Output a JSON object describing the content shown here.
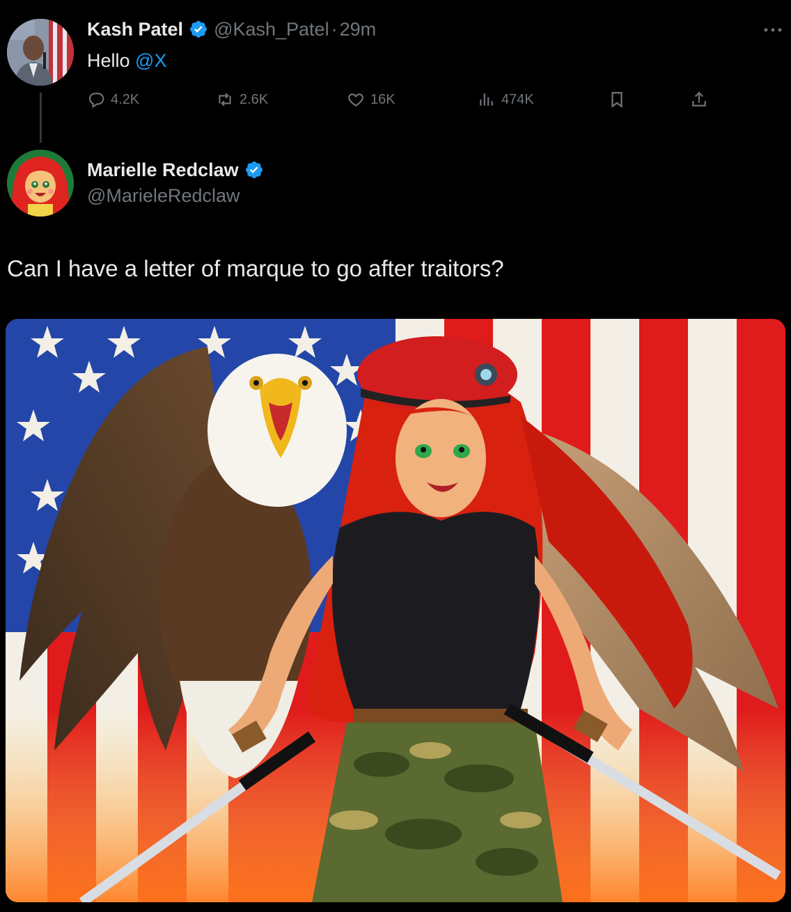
{
  "parent_tweet": {
    "display_name": "Kash Patel",
    "handle": "@Kash_Patel",
    "separator": "·",
    "time": "29m",
    "text_prefix": "Hello ",
    "mention": "@X",
    "actions": {
      "replies": "4.2K",
      "reposts": "2.6K",
      "likes": "16K",
      "views": "474K"
    },
    "icons": [
      "more-icon",
      "verified-icon",
      "reply-icon",
      "repost-icon",
      "like-icon",
      "views-icon",
      "bookmark-icon",
      "share-icon"
    ]
  },
  "main_tweet": {
    "display_name": "Marielle Redclaw",
    "handle": "@MarieleRedclaw",
    "text": "Can I have a letter of marque to go after traitors?",
    "media": "illustration of a red-haired woman in a red beret holding two katanas in front of a bald eagle and an American flag"
  },
  "colors": {
    "background": "#000000",
    "text_primary": "#e7e9ea",
    "text_secondary": "#71767b",
    "accent": "#1d9bf0",
    "verified": "#1d9bf0"
  }
}
